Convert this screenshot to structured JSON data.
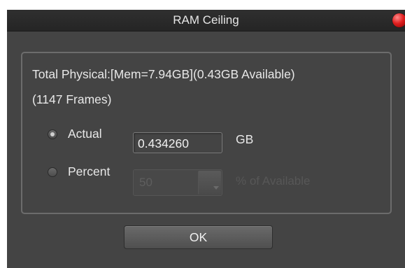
{
  "window": {
    "title": "RAM Ceiling"
  },
  "memory_info": {
    "line1": "Total Physical:[Mem=7.94GB](0.43GB Available)",
    "line2": "(1147 Frames)"
  },
  "options": {
    "actual": {
      "label": "Actual",
      "selected": true,
      "value": "0.434260",
      "unit": "GB"
    },
    "percent": {
      "label": "Percent",
      "selected": false,
      "value": "50",
      "unit": "% of Available",
      "enabled": false
    }
  },
  "buttons": {
    "ok_label": "OK"
  },
  "colors": {
    "window_bg": "#444444",
    "titlebar_bg": "#2a2a2a",
    "close_button": "#e02020",
    "text": "#e8e8e8",
    "disabled_text": "#575757"
  },
  "icons": {
    "close": "close-icon",
    "spin_down": "chevron-down-icon"
  }
}
